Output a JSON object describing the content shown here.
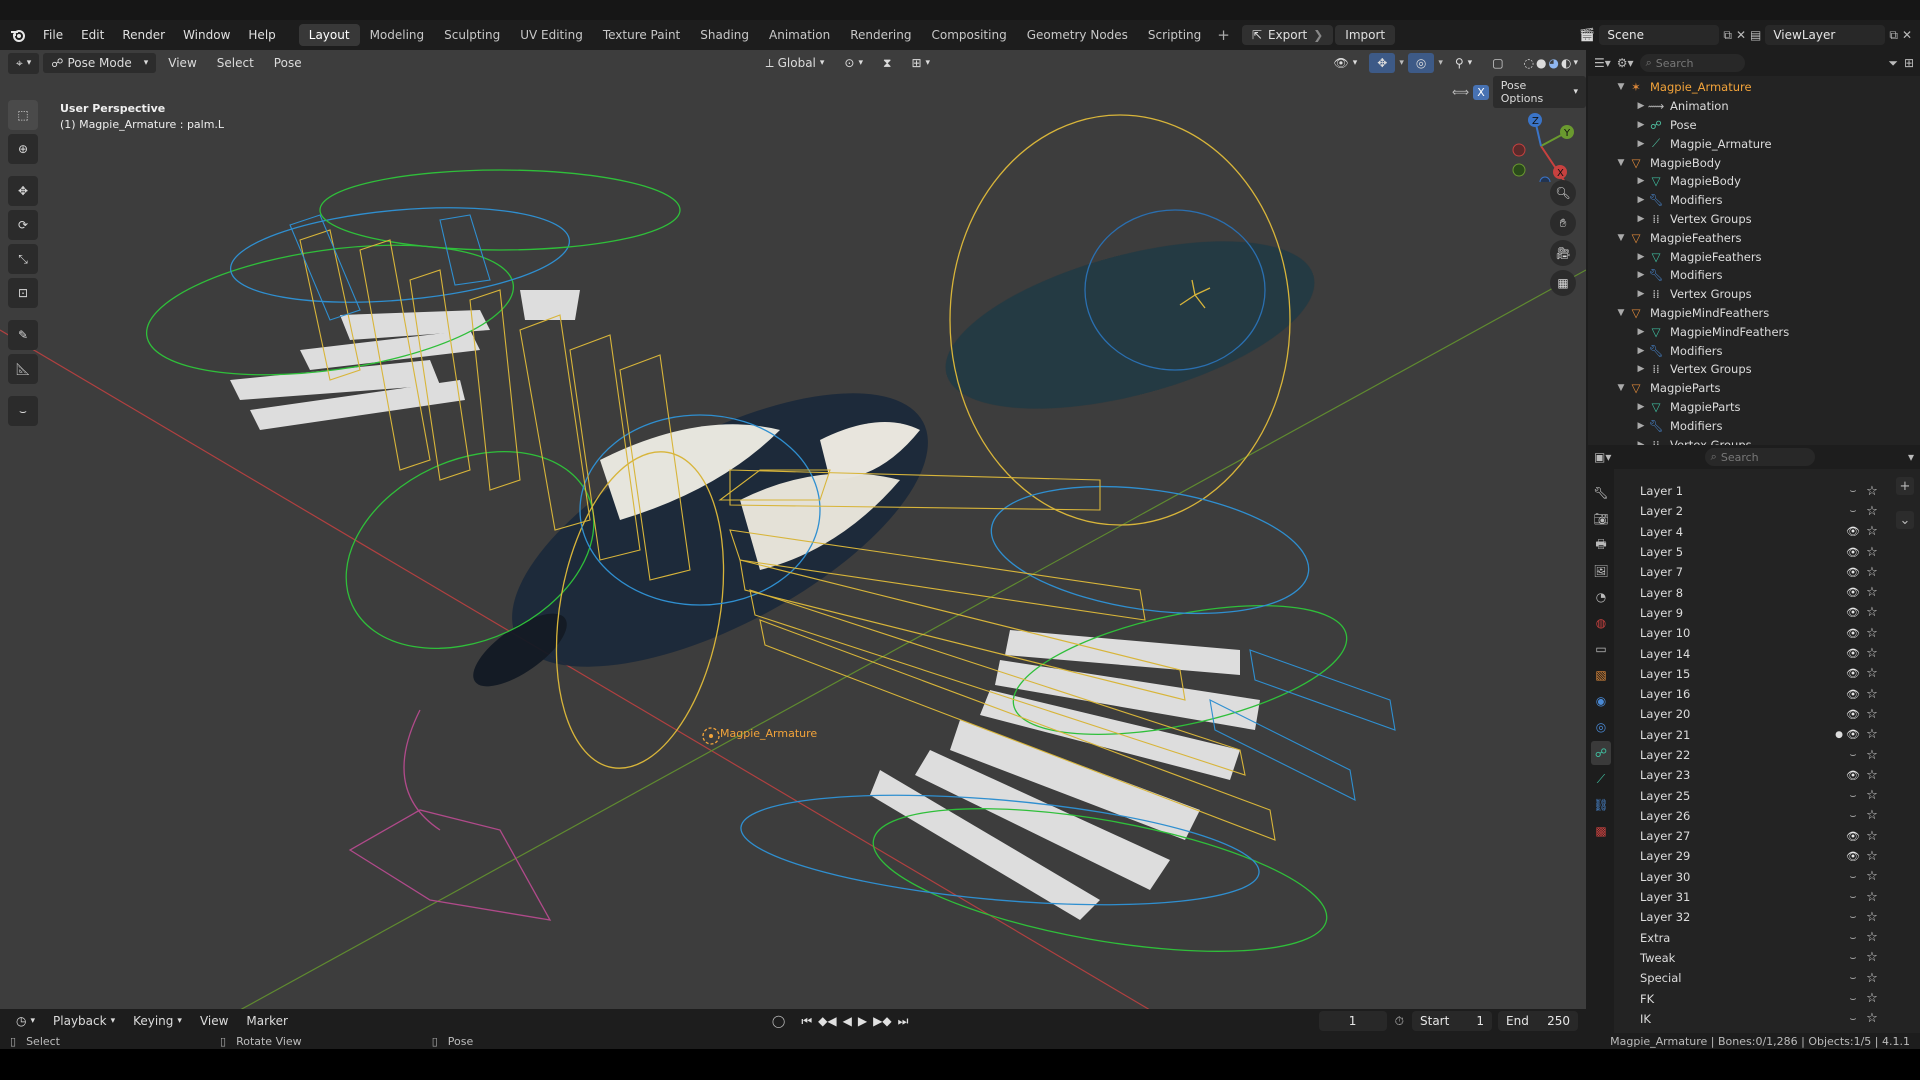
{
  "menubar": {
    "menus": [
      "File",
      "Edit",
      "Render",
      "Window",
      "Help"
    ],
    "workspaces": [
      "Layout",
      "Modeling",
      "Sculpting",
      "UV Editing",
      "Texture Paint",
      "Shading",
      "Animation",
      "Rendering",
      "Compositing",
      "Geometry Nodes",
      "Scripting"
    ],
    "active_workspace": "Layout",
    "add_workspace": "+",
    "export_label": "Export",
    "import_label": "Import",
    "scene": "Scene",
    "view_layer": "ViewLayer"
  },
  "viewport": {
    "mode": "Pose Mode",
    "menus": [
      "View",
      "Select",
      "Pose"
    ],
    "transform_orientation": "Global",
    "pose_options": "Pose Options",
    "x_mirror": "X",
    "overlay_title": "User Perspective",
    "overlay_subtitle": "(1) Magpie_Armature : palm.L",
    "armature_label": "Magpie_Armature",
    "gizmo_axes": {
      "x": "X",
      "y": "Y",
      "z": "Z"
    }
  },
  "timeline": {
    "menus": [
      "Playback",
      "Keying",
      "View",
      "Marker"
    ],
    "current_frame": "1",
    "start_label": "Start",
    "start": "1",
    "end_label": "End",
    "end": "250"
  },
  "statusbar": {
    "select": "Select",
    "rotate": "Rotate View",
    "pose": "Pose",
    "stats": "Magpie_Armature | Bones:0/1,286 | Objects:1/5 | 4.1.1"
  },
  "outliner": {
    "search_placeholder": "Search",
    "rows": [
      {
        "label": "Magpie_Armature",
        "depth": 0,
        "expanded": true,
        "icon": "armature-icon",
        "highlight": true
      },
      {
        "label": "Animation",
        "depth": 1,
        "expanded": false,
        "icon": "animation-icon"
      },
      {
        "label": "Pose",
        "depth": 1,
        "expanded": false,
        "icon": "pose-icon"
      },
      {
        "label": "Magpie_Armature",
        "depth": 1,
        "expanded": false,
        "icon": "armature-data-icon"
      },
      {
        "label": "MagpieBody",
        "depth": 0,
        "expanded": true,
        "icon": "object-icon"
      },
      {
        "label": "MagpieBody",
        "depth": 1,
        "expanded": false,
        "icon": "mesh-icon"
      },
      {
        "label": "Modifiers",
        "depth": 1,
        "expanded": false,
        "icon": "wrench-icon"
      },
      {
        "label": "Vertex Groups",
        "depth": 1,
        "expanded": false,
        "icon": "vertex-groups-icon"
      },
      {
        "label": "MagpieFeathers",
        "depth": 0,
        "expanded": true,
        "icon": "object-icon"
      },
      {
        "label": "MagpieFeathers",
        "depth": 1,
        "expanded": false,
        "icon": "mesh-icon"
      },
      {
        "label": "Modifiers",
        "depth": 1,
        "expanded": false,
        "icon": "wrench-icon"
      },
      {
        "label": "Vertex Groups",
        "depth": 1,
        "expanded": false,
        "icon": "vertex-groups-icon"
      },
      {
        "label": "MagpieMindFeathers",
        "depth": 0,
        "expanded": true,
        "icon": "object-icon"
      },
      {
        "label": "MagpieMindFeathers",
        "depth": 1,
        "expanded": false,
        "icon": "mesh-icon"
      },
      {
        "label": "Modifiers",
        "depth": 1,
        "expanded": false,
        "icon": "wrench-icon"
      },
      {
        "label": "Vertex Groups",
        "depth": 1,
        "expanded": false,
        "icon": "vertex-groups-icon"
      },
      {
        "label": "MagpieParts",
        "depth": 0,
        "expanded": true,
        "icon": "object-icon"
      },
      {
        "label": "MagpieParts",
        "depth": 1,
        "expanded": false,
        "icon": "mesh-icon"
      },
      {
        "label": "Modifiers",
        "depth": 1,
        "expanded": false,
        "icon": "wrench-icon"
      },
      {
        "label": "Vertex Groups",
        "depth": 1,
        "expanded": false,
        "icon": "vertex-groups-icon"
      }
    ]
  },
  "properties": {
    "search_placeholder": "Search",
    "layers": [
      {
        "name": "Layer 1",
        "visible": false
      },
      {
        "name": "Layer 2",
        "visible": false
      },
      {
        "name": "Layer 4",
        "visible": true
      },
      {
        "name": "Layer 5",
        "visible": true
      },
      {
        "name": "Layer 7",
        "visible": true
      },
      {
        "name": "Layer 8",
        "visible": true
      },
      {
        "name": "Layer 9",
        "visible": true
      },
      {
        "name": "Layer 10",
        "visible": true
      },
      {
        "name": "Layer 14",
        "visible": true
      },
      {
        "name": "Layer 15",
        "visible": true
      },
      {
        "name": "Layer 16",
        "visible": true
      },
      {
        "name": "Layer 20",
        "visible": true
      },
      {
        "name": "Layer 21",
        "visible": true,
        "active": true
      },
      {
        "name": "Layer 22",
        "visible": false
      },
      {
        "name": "Layer 23",
        "visible": true
      },
      {
        "name": "Layer 25",
        "visible": false
      },
      {
        "name": "Layer 26",
        "visible": false
      },
      {
        "name": "Layer 27",
        "visible": true
      },
      {
        "name": "Layer 29",
        "visible": true
      },
      {
        "name": "Layer 30",
        "visible": false
      },
      {
        "name": "Layer 31",
        "visible": false
      },
      {
        "name": "Layer 32",
        "visible": false
      },
      {
        "name": "Extra",
        "visible": false
      },
      {
        "name": "Tweak",
        "visible": false
      },
      {
        "name": "Special",
        "visible": false
      },
      {
        "name": "FK",
        "visible": false
      },
      {
        "name": "IK",
        "visible": false
      }
    ]
  },
  "colors": {
    "accent": "#4772b3",
    "armature_highlight": "#f2a33a",
    "bone_yellow": "#e3c23a",
    "bone_blue": "#2f8fd0",
    "bone_green": "#2fbf3a",
    "axis_x": "#c8413f",
    "axis_y": "#6a9a2f"
  }
}
